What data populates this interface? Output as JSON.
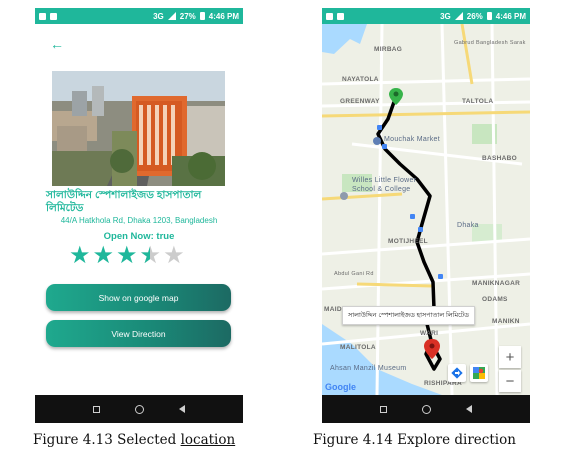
{
  "left_screen": {
    "status": {
      "network": "3G",
      "battery": "27%",
      "time": "4:46 PM"
    },
    "place_name": "সালাউদ্দিন স্পেশালাইজড হাসপাতাল লিমিটেড",
    "address": "44/A Hatkhola Rd, Dhaka 1203, Bangladesh",
    "open_now": "Open Now: true",
    "rating": 3.5,
    "rating_max": 5,
    "buttons": {
      "show_map": "Show on google map",
      "view_direction": "View Direction"
    }
  },
  "right_screen": {
    "status": {
      "network": "3G",
      "battery": "26%",
      "time": "4:46 PM"
    },
    "map_labels": [
      "MIRBAG",
      "Gabrud Bangladesh Sarak",
      "NAYATOLA",
      "GREENWAY",
      "TALTOLA",
      "Mouchak Market",
      "BASHABO",
      "Willes Little Flower School & College",
      "Dhaka",
      "MOTIJHEEL",
      "Abdul Gani Rd",
      "MANIKNAGAR",
      "MAIDAN",
      "ODAMS",
      "MANIKN",
      "MALITOLA",
      "WARI",
      "Ahsan Manzil Museum",
      "RISHIPARA"
    ],
    "callout": "সালাউদ্দিন স্পেশালাইজড হাসপাতাল লিমিটেড",
    "zoom_in": "+",
    "zoom_out": "−",
    "google_logo": "Google"
  },
  "captions": {
    "left": "Figure 4.13 Selected location",
    "left_main": "Figure 4.13 Selected ",
    "left_underlined": "location",
    "right": "Figure 4.14 Explore direction"
  },
  "colors": {
    "accent": "#1fb79b",
    "route": "#000000",
    "start_pin": "#37b34a",
    "end_pin": "#d93025"
  }
}
